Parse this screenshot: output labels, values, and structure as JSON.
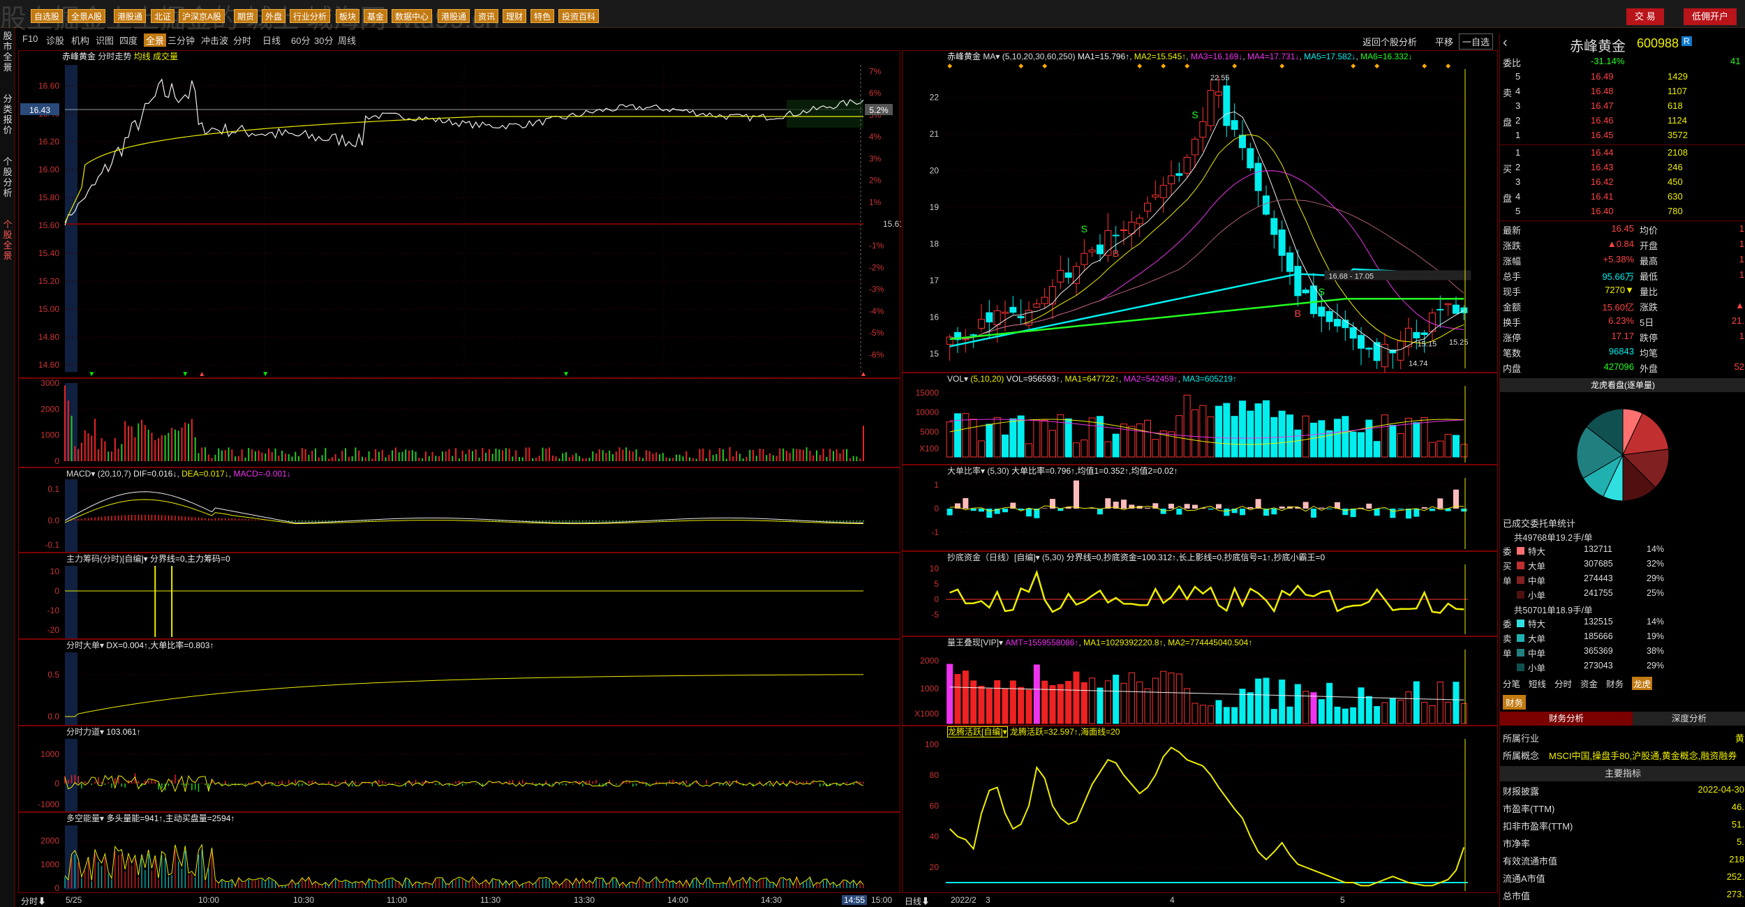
{
  "top": {
    "buttons": [
      "自选股",
      "全景A股",
      "港股通",
      "北证",
      "沪深京A股",
      "期货",
      "外盘",
      "行业分析",
      "板块",
      "基金",
      "数据中心",
      "港股通",
      "资讯",
      "理财",
      "特色",
      "投资百科"
    ],
    "trade": "交 易",
    "open": "低佣开户",
    "watermark": "股上掘金上上掘金的 城上 城海网 wtu99.cn"
  },
  "sidebar": [
    "股市全景",
    "分类报价",
    "个股分析",
    "个股全景"
  ],
  "toolbar": {
    "items": [
      "F10",
      "诊股",
      "机构",
      "识图",
      "四度",
      "全景",
      "三分钟",
      "冲击波",
      "分时",
      "日线",
      "60分",
      "30分",
      "周线"
    ],
    "right": [
      "返回个股分析",
      "平移",
      "一自选"
    ]
  },
  "intraday": {
    "header": {
      "name": "赤峰黄金",
      "type": "分时走势",
      "extra": "均线 成交量"
    },
    "left_ticks": [
      "16.60",
      "16.40",
      "16.20",
      "16.00",
      "15.80",
      "15.60",
      "15.40",
      "15.20",
      "15.00",
      "14.80",
      "14.60"
    ],
    "current_price": "16.43",
    "pct_ticks": [
      "7%",
      "6%",
      "5%",
      "4%",
      "3%",
      "2%",
      "1%",
      "-1%",
      "-2%",
      "-3%",
      "-4%",
      "-5%",
      "-6%"
    ],
    "cur_pct": "5.2%",
    "ref_price": "15.61",
    "vol_ticks": [
      "3000",
      "2000",
      "1000",
      "0"
    ],
    "macd": {
      "label": "MACD▾",
      "params": "(20,10,7)",
      "dif": "DIF=0.016↓",
      "dea": "DEA=0.017↓",
      "macd": "MACD=-0.001↓",
      "ticks": [
        "0.1",
        "0.0",
        "-0.1"
      ]
    },
    "main_chip": {
      "label": "主力筹码(分时)[自编]▾",
      "text": "分界线=0,主力筹码=0",
      "ticks": [
        "10",
        "0",
        "-10",
        "-20"
      ]
    },
    "big_order": {
      "label": "分时大单▾",
      "text": "DX=0.004↑,大单比率=0.803↑",
      "ticks": [
        "0.5",
        "0.0"
      ]
    },
    "force": {
      "label": "分时力道▾",
      "text": "103.061↑",
      "ticks": [
        "1000",
        "0",
        "-1000"
      ]
    },
    "energy": {
      "label": "多空能量▾",
      "text": "多头量能=941↑,主动买盘量=2594↑",
      "ticks": [
        "2000",
        "1000",
        "0"
      ]
    },
    "time_axis": [
      "5/25",
      "10:00",
      "10:30",
      "11:00",
      "11:30",
      "13:30",
      "14:00",
      "14:30",
      "14:55",
      "15:00"
    ],
    "time_label": "分时⬇"
  },
  "kline": {
    "header": {
      "name": "赤峰黄金",
      "ma": "MA▾",
      "params": "(5,10,20,30,60,250)",
      "ma1": "MA1=15.796↑",
      "ma2": "MA2=15.545↑",
      "ma3": "MA3=16.169↓",
      "ma4": "MA4=17.731↓",
      "ma5": "MA5=17.582↓",
      "ma6": "MA6=16.332↓"
    },
    "ticks": [
      "22",
      "21",
      "20",
      "19",
      "18",
      "17",
      "16",
      "15"
    ],
    "annot": {
      "high": "22.55",
      "range": "16.68 - 17.05",
      "low": "14.74",
      "p1": "15.15",
      "p2": "15.25"
    },
    "vol": {
      "label": "VOL▾",
      "params": "(5,10,20)",
      "vol": "VOL=956593↑",
      "ma1": "MA1=647722↑",
      "ma2": "MA2=542459↑",
      "ma3": "MA3=605219↑",
      "ticks": [
        "15000",
        "10000",
        "5000",
        "X100"
      ]
    },
    "bigratio": {
      "label": "大单比率▾",
      "params": "(5,30)",
      "text": "大单比率=0.796↑,均值1=0.352↑,均值2=0.02↑",
      "ticks": [
        "1",
        "0",
        "-1"
      ]
    },
    "bottom": {
      "label": "抄底资金（日线）[自编]▾",
      "params": "(5,30)",
      "text": "分界线=0,抄底资金=100.312↑,长上影线=0,抄底信号=1↑,抄底小霸王=0",
      "ticks": [
        "10",
        "5",
        "0",
        "-5"
      ]
    },
    "king": {
      "label": "量王叠现[VIP]▾",
      "amt": "AMT=1559558086↑",
      "ma1": "MA1=1029392220.8↑",
      "ma2": "MA2=774445040.504↑",
      "ticks": [
        "2000",
        "1000",
        "X1000"
      ]
    },
    "dragon": {
      "label": "龙腾活跃[自编]▾",
      "text": "龙腾活跃=32.597↑,海面线=20",
      "ticks": [
        "100",
        "80",
        "60",
        "40",
        "20"
      ]
    },
    "time_axis": [
      "2022/2",
      "3",
      "4",
      "5"
    ],
    "time_label": "日线⬇"
  },
  "quote": {
    "name": "赤峰黄金",
    "code": "600988",
    "badge": "R",
    "weibi": {
      "label": "委比",
      "pct": "-31.14%",
      "val": "41"
    },
    "sells": [
      {
        "lv": "5",
        "p": "16.49",
        "v": "1429"
      },
      {
        "lv": "4",
        "p": "16.48",
        "v": "1107"
      },
      {
        "lv": "3",
        "p": "16.47",
        "v": "618"
      },
      {
        "lv": "2",
        "p": "16.46",
        "v": "1124"
      },
      {
        "lv": "1",
        "p": "16.45",
        "v": "3572"
      }
    ],
    "buys": [
      {
        "lv": "1",
        "p": "16.44",
        "v": "2108"
      },
      {
        "lv": "2",
        "p": "16.43",
        "v": "246"
      },
      {
        "lv": "3",
        "p": "16.42",
        "v": "450"
      },
      {
        "lv": "4",
        "p": "16.41",
        "v": "630"
      },
      {
        "lv": "5",
        "p": "16.40",
        "v": "780"
      }
    ],
    "sell_label": "卖",
    "buy_label": "买",
    "pan": "盘",
    "stats": [
      {
        "a": "最新",
        "av": "16.45",
        "b": "均价",
        "bv": "1"
      },
      {
        "a": "涨跌",
        "av": "▲0.84",
        "b": "开盘",
        "bv": "1"
      },
      {
        "a": "涨幅",
        "av": "+5.38%",
        "b": "最高",
        "bv": "1"
      },
      {
        "a": "总手",
        "av": "95.66万",
        "b": "最低",
        "bv": "1"
      },
      {
        "a": "现手",
        "av": "7270▼",
        "b": "量比",
        "bv": ""
      },
      {
        "a": "金额",
        "av": "15.60亿",
        "b": "涨跌",
        "bv": "▲"
      },
      {
        "a": "换手",
        "av": "6.23%",
        "b": "5日",
        "bv": "21."
      },
      {
        "a": "涨停",
        "av": "17.17",
        "b": "跌停",
        "bv": "1"
      },
      {
        "a": "笔数",
        "av": "96843",
        "b": "均笔",
        "bv": ""
      },
      {
        "a": "内盘",
        "av": "427096",
        "b": "外盘",
        "bv": "52"
      }
    ],
    "pie_title": "龙虎看盘(逐单量)",
    "pie": [
      {
        "v": 14,
        "color": "#ff7070"
      },
      {
        "v": 32,
        "color": "#c03030"
      },
      {
        "v": 29,
        "color": "#802020"
      },
      {
        "v": 25,
        "color": "#501010"
      },
      {
        "v": 14,
        "color": "#30e0e0"
      },
      {
        "v": 19,
        "color": "#20b0b0"
      },
      {
        "v": 38,
        "color": "#208080"
      },
      {
        "v": 29,
        "color": "#105050"
      }
    ],
    "deal_title": "已成交委托单统计",
    "buy_total": "共49768单19.2手/单",
    "buy_rows": [
      {
        "n": "特大",
        "v": "132711",
        "p": "14%"
      },
      {
        "n": "大单",
        "v": "307685",
        "p": "32%"
      },
      {
        "n": "中单",
        "v": "274443",
        "p": "29%"
      },
      {
        "n": "小单",
        "v": "241755",
        "p": "25%"
      }
    ],
    "buy_side": [
      "委",
      "买",
      "单"
    ],
    "sell_total": "共50701单18.9手/单",
    "sell_rows": [
      {
        "n": "特大",
        "v": "132515",
        "p": "14%"
      },
      {
        "n": "大单",
        "v": "185666",
        "p": "19%"
      },
      {
        "n": "中单",
        "v": "365369",
        "p": "38%"
      },
      {
        "n": "小单",
        "v": "273043",
        "p": "29%"
      }
    ],
    "sell_side": [
      "委",
      "卖",
      "单"
    ],
    "tabs": [
      "分笔",
      "短线",
      "分时",
      "资金",
      "财务",
      "龙虎"
    ],
    "fin_tab": "财务",
    "fin_tabs": [
      "财务分析",
      "深度分析"
    ],
    "fin": [
      {
        "k": "所属行业",
        "v": "黄"
      },
      {
        "k": "所属概念",
        "v": "MSCI中国,操盘手80,沪股通,黄金概念,融资融券"
      },
      {
        "k": "主要指标",
        "v": "",
        "hdr": true
      },
      {
        "k": "财报披露",
        "v": "2022-04-30"
      },
      {
        "k": "市盈率(TTM)",
        "v": "46."
      },
      {
        "k": "扣非市盈率(TTM)",
        "v": "51."
      },
      {
        "k": "市净率",
        "v": "5."
      },
      {
        "k": "有效流通市值",
        "v": "218"
      },
      {
        "k": "流通A市值",
        "v": "252."
      },
      {
        "k": "总市值",
        "v": "273."
      }
    ]
  }
}
